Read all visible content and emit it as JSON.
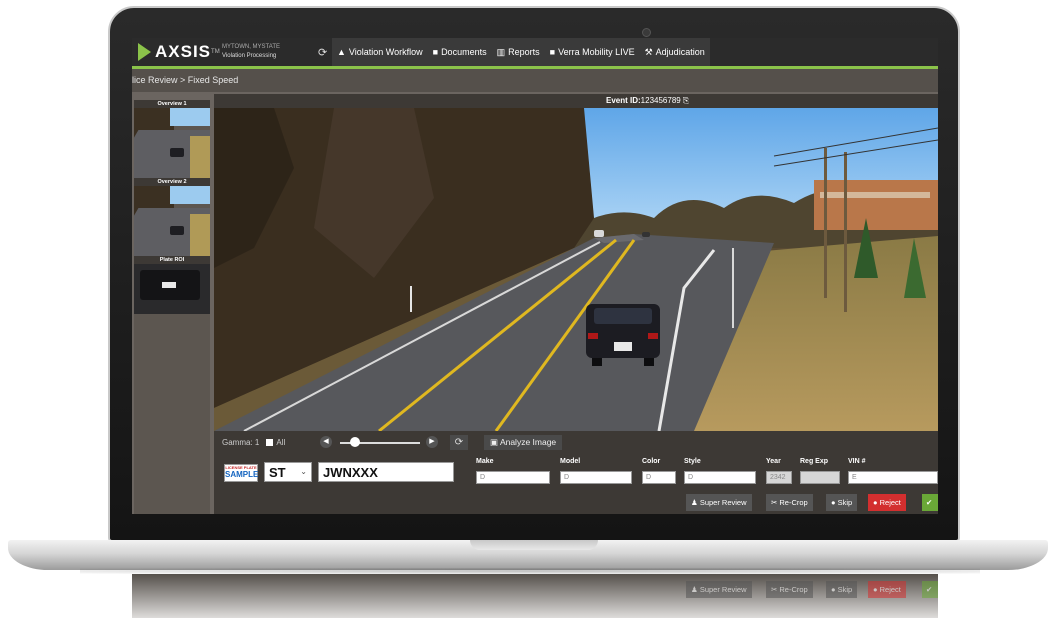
{
  "app": {
    "logo": "AXSIS",
    "logo_tm": "TM",
    "account_line1": "MYTOWN, MYSTATE",
    "account_line2": "Violation Processing"
  },
  "nav": {
    "tabs": [
      {
        "label": "Violation Workflow",
        "icon": "warning-icon"
      },
      {
        "label": "Documents",
        "icon": "folder-icon"
      },
      {
        "label": "Reports",
        "icon": "chart-icon"
      },
      {
        "label": "Verra Mobility LIVE",
        "icon": "video-icon"
      },
      {
        "label": "Adjudication",
        "icon": "gavel-icon"
      }
    ]
  },
  "breadcrumb": "lice Review > Fixed Speed",
  "sidebar": {
    "overview1": "Overview 1",
    "overview2": "Overview 2",
    "plate_roi": "Plate ROI"
  },
  "event": {
    "label": "Event ID:",
    "id": "123456789"
  },
  "controls": {
    "gamma_label": "Gamma: 1",
    "all_label": "All",
    "analyze_label": "Analyze Image"
  },
  "plate": {
    "badge_top": "LICENSE PLATE",
    "badge_main": "SAMPLE",
    "state": "ST",
    "number": "JWNXXX"
  },
  "vehicle": {
    "make_label": "Make",
    "make_value": "D",
    "model_label": "Model",
    "model_value": "D",
    "color_label": "Color",
    "color_value": "D",
    "style_label": "Style",
    "style_value": "D",
    "year_label": "Year",
    "year_value": "2342",
    "regexp_label": "Reg Exp",
    "regexp_value": "",
    "vin_label": "VIN #",
    "vin_value": "E"
  },
  "actions": {
    "super_review": "Super Review",
    "recrop": "Re-Crop",
    "skip": "Skip",
    "reject": "Reject",
    "accept": "✔"
  },
  "colors": {
    "accent_green": "#8bc34a",
    "reject_red": "#d32f2f",
    "accept_green": "#6aa837"
  }
}
